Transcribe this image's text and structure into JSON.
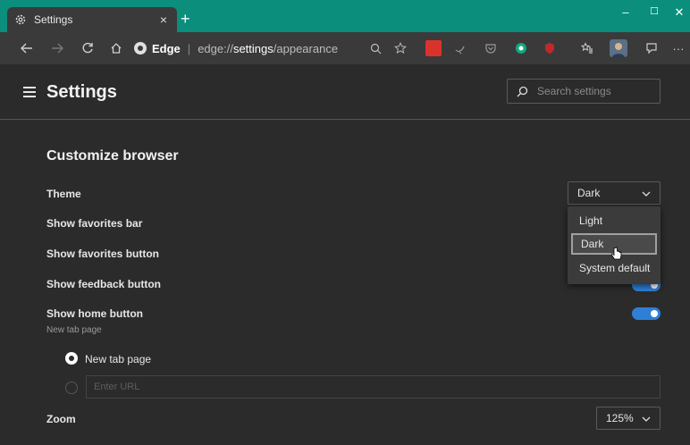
{
  "browser": {
    "tab_title": "Settings",
    "tab_close": "×",
    "new_tab": "+",
    "window_minimize": "–",
    "window_maximize": "☐",
    "window_close": "✕",
    "address_brand": "Edge",
    "address_separator": "|",
    "address_scheme": "edge://",
    "address_path_bold": "settings",
    "address_path_rest": "/appearance",
    "more_menu": "···",
    "colors": {
      "titlebar": "#0b8f7c",
      "toolbar": "#3a3a3a",
      "accent": "#2f7fd6"
    }
  },
  "settings": {
    "title": "Settings",
    "search_placeholder": "Search settings"
  },
  "section": {
    "title": "Customize browser",
    "theme_label": "Theme",
    "theme_value": "Dark",
    "theme_options": [
      "Light",
      "Dark",
      "System default"
    ],
    "show_favorites_bar": "Show favorites bar",
    "show_favorites_button": "Show favorites button",
    "show_feedback_button": "Show feedback button",
    "show_home_button": "Show home button",
    "home_sublabel": "New tab page",
    "radio_new_tab": "New tab page",
    "url_placeholder": "Enter URL",
    "zoom_label": "Zoom",
    "zoom_value": "125%"
  }
}
